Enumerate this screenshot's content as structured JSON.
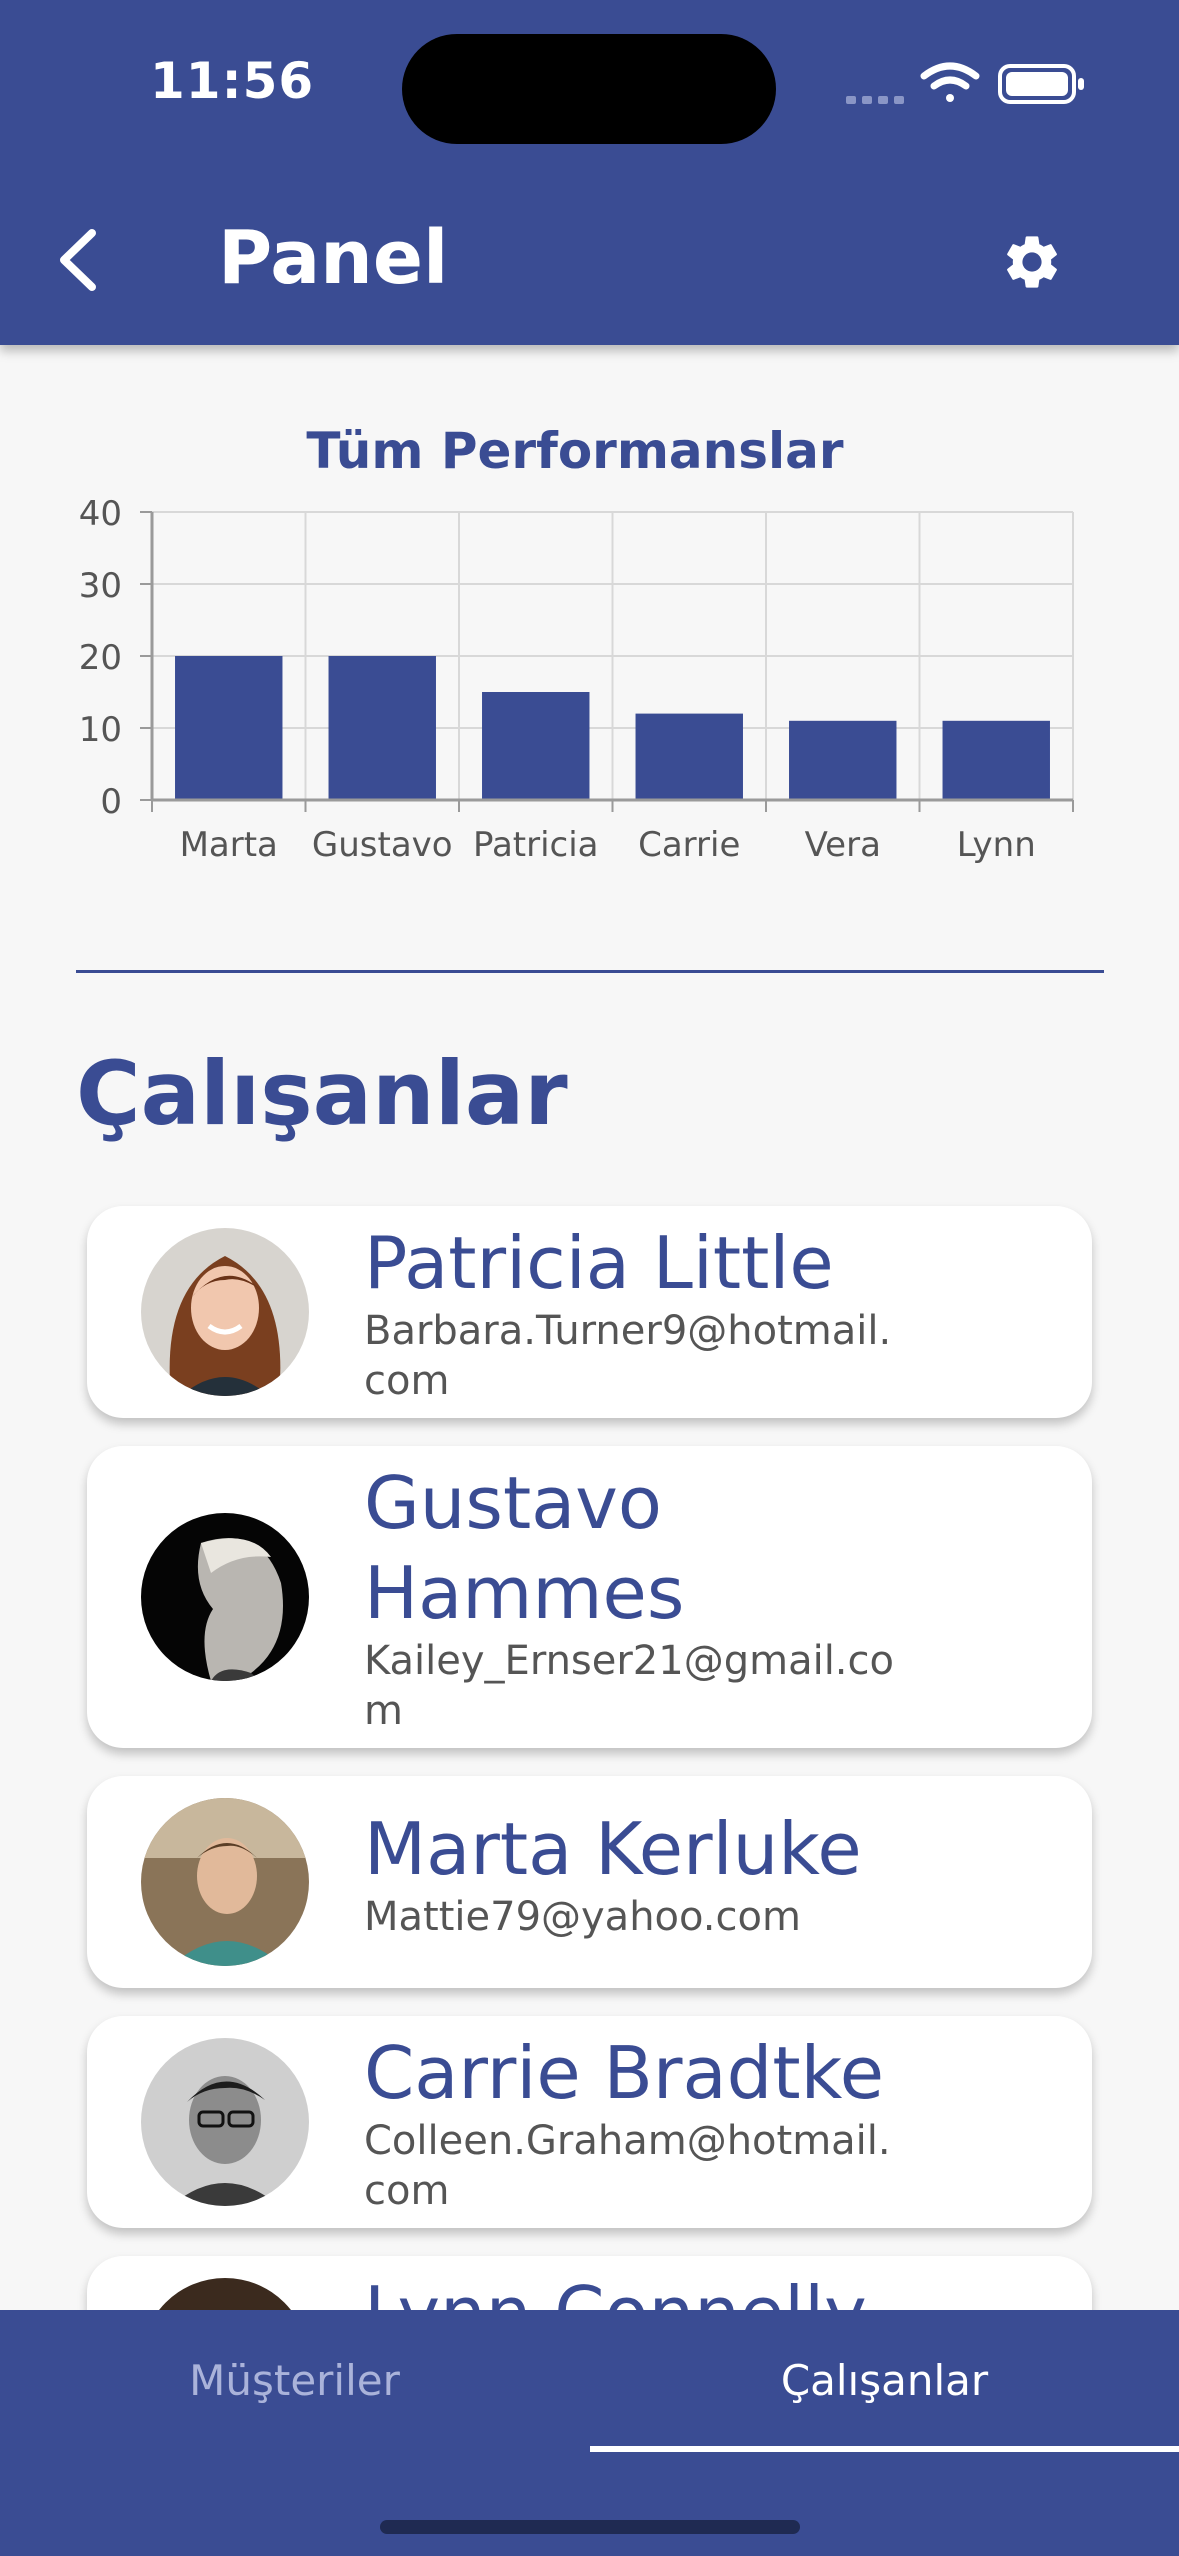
{
  "status_bar": {
    "time": "11:56"
  },
  "header": {
    "title": "Panel"
  },
  "chart_data": {
    "type": "bar",
    "title": "Tüm Performanslar",
    "categories": [
      "Marta",
      "Gustavo",
      "Patricia",
      "Carrie",
      "Vera",
      "Lynn"
    ],
    "values": [
      20,
      20,
      15,
      12,
      11,
      11
    ],
    "ylim": [
      0,
      40
    ],
    "yticks": [
      0,
      10,
      20,
      30,
      40
    ],
    "grid": true,
    "bar_color": "#3a4c93"
  },
  "employees_section": {
    "title": "Çalışanlar"
  },
  "employees": [
    {
      "name": "Patricia Little",
      "email": "Barbara.Turner9@hotmail.com"
    },
    {
      "name": "Gustavo Hammes",
      "email": "Kailey_Ernser21@gmail.com"
    },
    {
      "name": "Marta Kerluke",
      "email": "Mattie79@yahoo.com"
    },
    {
      "name": "Carrie Bradtke",
      "email": "Colleen.Graham@hotmail.com"
    },
    {
      "name": "Lynn Connelly",
      "email": ""
    }
  ],
  "bottom_nav": {
    "tabs": [
      {
        "label": "Müşteriler",
        "active": false
      },
      {
        "label": "Çalışanlar",
        "active": true
      }
    ]
  },
  "colors": {
    "primary": "#3a4c93",
    "background": "#f7f7f7"
  },
  "icons": {
    "back": "chevron-left-icon",
    "settings": "gear-icon"
  }
}
